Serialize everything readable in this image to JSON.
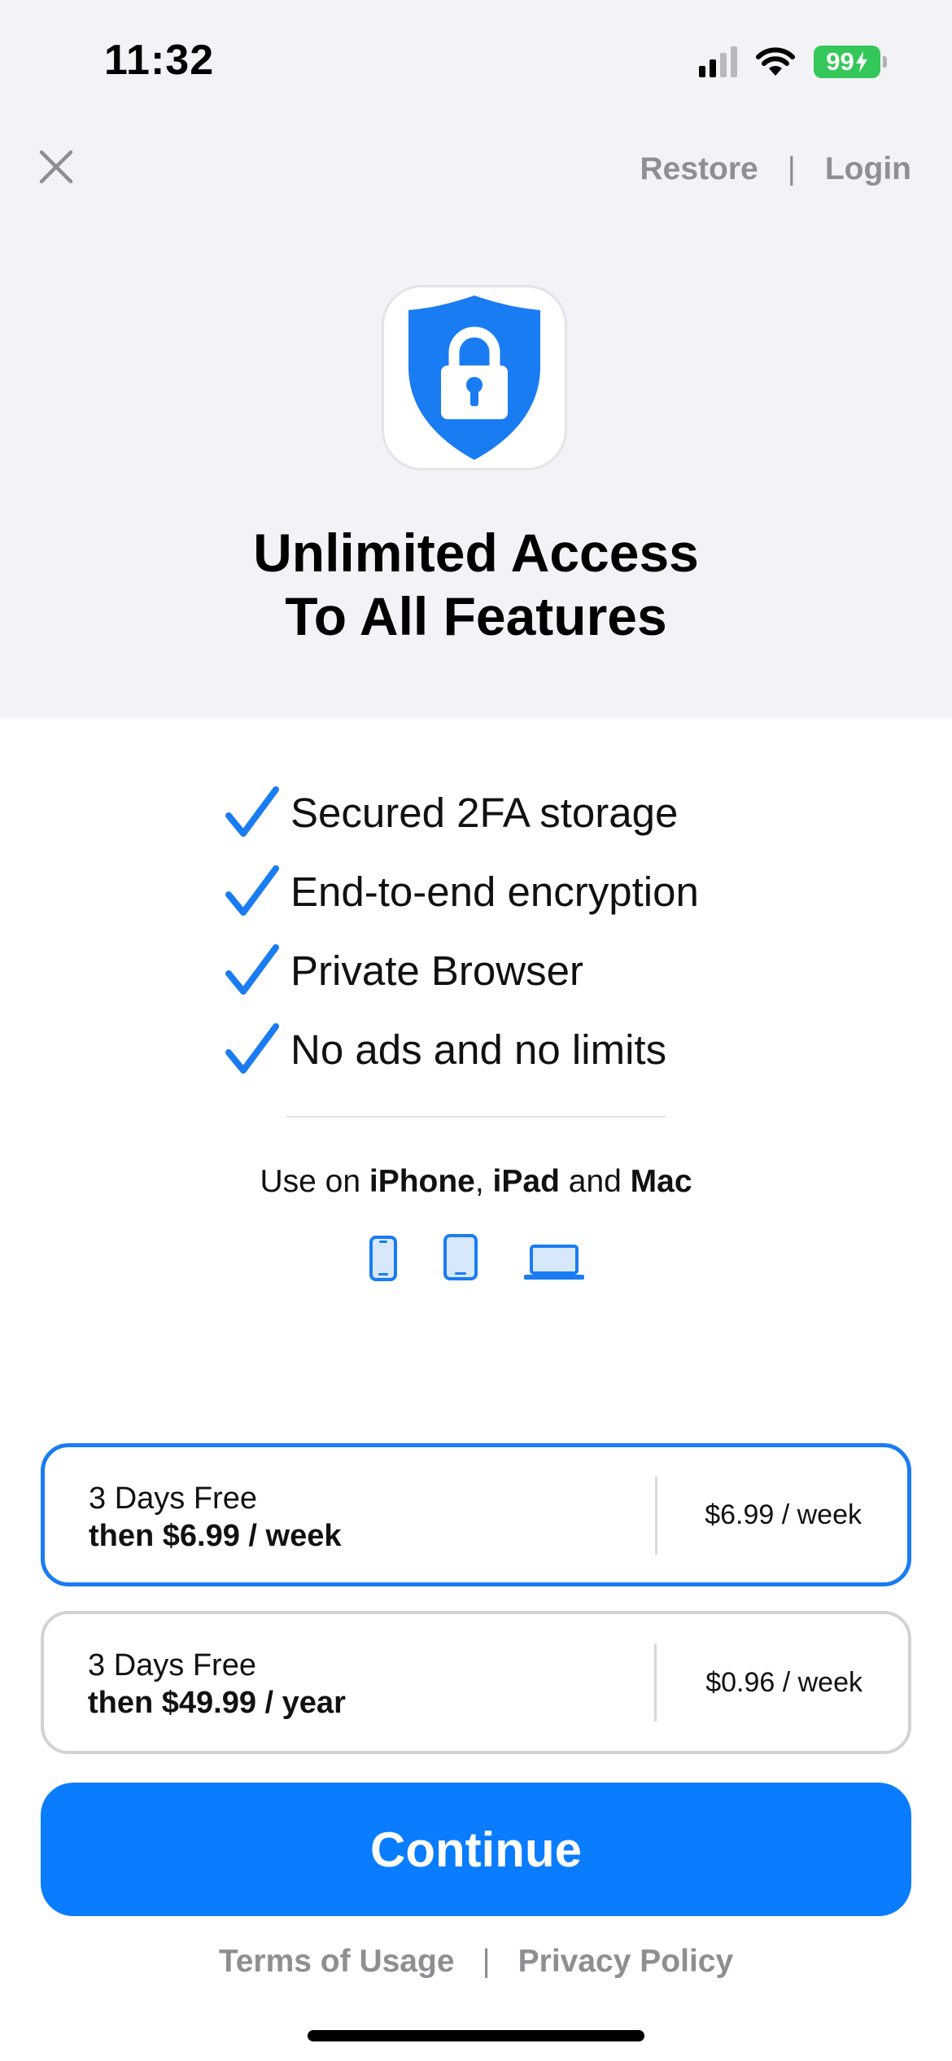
{
  "status_bar": {
    "time": "11:32",
    "battery_level": "99",
    "signal_bars_active": 2,
    "signal_bars_total": 4
  },
  "nav": {
    "restore_label": "Restore",
    "separator": "|",
    "login_label": "Login"
  },
  "hero": {
    "title_line1": "Unlimited Access",
    "title_line2": "To All Features"
  },
  "features": [
    {
      "text": "Secured 2FA storage"
    },
    {
      "text": "End-to-end encryption"
    },
    {
      "text": "Private Browser"
    },
    {
      "text": "No ads and no limits"
    }
  ],
  "devices": {
    "prefix": "Use on ",
    "device1": "iPhone",
    "comma": ", ",
    "device2": "iPad",
    "and": " and ",
    "device3": "Mac",
    "icons": [
      "iphone-icon",
      "ipad-icon",
      "laptop-icon"
    ]
  },
  "plans": [
    {
      "trial": "3 Days Free",
      "price_line": "then $6.99 / week",
      "weekly_price": "$6.99 / week",
      "selected": true
    },
    {
      "trial": "3 Days Free",
      "price_line": "then $49.99 / year",
      "weekly_price": "$0.96 / week",
      "selected": false
    }
  ],
  "cta": {
    "continue_label": "Continue"
  },
  "footer": {
    "terms_label": "Terms of Usage",
    "separator": "|",
    "privacy_label": "Privacy Policy"
  },
  "colors": {
    "accent": "#0a7cff",
    "header_bg": "#f2f2f7",
    "battery": "#34c759",
    "muted_text": "#8e8e93",
    "selected_border": "#1a7cf2",
    "unselected_border": "#d1d1d6"
  }
}
